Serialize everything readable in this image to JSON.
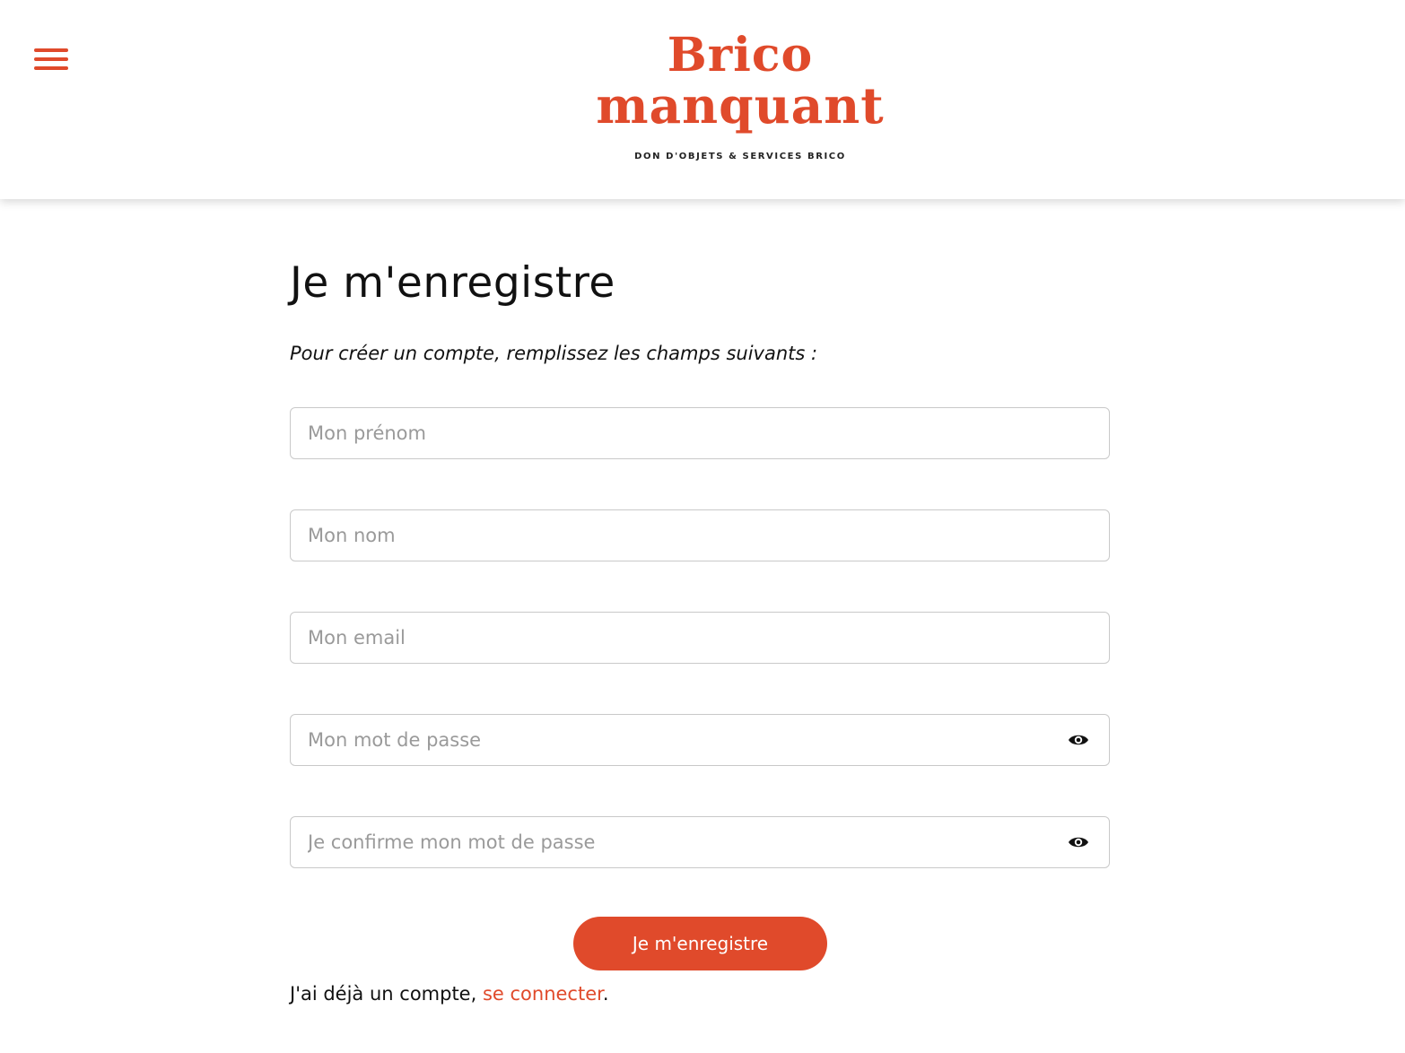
{
  "header": {
    "logo": {
      "line1": "Brico",
      "line2": "manquant",
      "tagline": "DON D'OBJETS & SERVICES BRICO"
    },
    "menu_icon": "hamburger-icon"
  },
  "form": {
    "title": "Je m'enregistre",
    "intro": "Pour créer un compte, remplissez les champs suivants :",
    "fields": [
      {
        "placeholder": "Mon prénom",
        "value": ""
      },
      {
        "placeholder": "Mon nom",
        "value": ""
      },
      {
        "placeholder": "Mon email",
        "value": ""
      },
      {
        "placeholder": "Mon mot de passe",
        "value": "",
        "icon": "eye-icon"
      },
      {
        "placeholder": "Je confirme mon mot de passe",
        "value": "",
        "icon": "eye-icon"
      }
    ],
    "submit_label": "Je m'enregistre",
    "login_prefix": "J'ai déjà un compte, ",
    "login_link": "se connecter",
    "login_suffix": "."
  },
  "colors": {
    "accent": "#e04a2b",
    "text": "#111111",
    "placeholder": "#9a9a9a",
    "border": "#c9c9c9"
  }
}
